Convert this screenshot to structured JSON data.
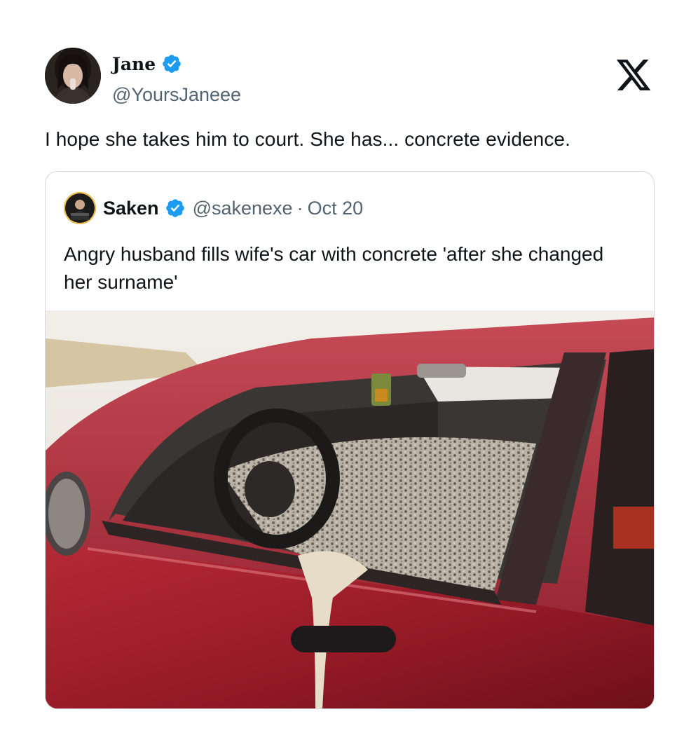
{
  "tweet": {
    "author_name": "Jane",
    "author_handle": "@YoursJaneee",
    "text": "I hope she takes him to court. She has... concrete evidence."
  },
  "quoted_tweet": {
    "author_name": "Saken",
    "author_handle": "@sakenexe",
    "separator": "·",
    "date": "Oct 20",
    "text": "Angry husband fills wife's car with concrete 'after she changed her surname'"
  },
  "icons": {
    "verified": "verified-badge-icon",
    "platform": "x-logo-icon"
  },
  "colors": {
    "verified_blue": "#1d9bf0",
    "text_primary": "#0f1419",
    "text_secondary": "#536471",
    "border": "#cfd9de",
    "car_red": "#9e1c2a"
  }
}
